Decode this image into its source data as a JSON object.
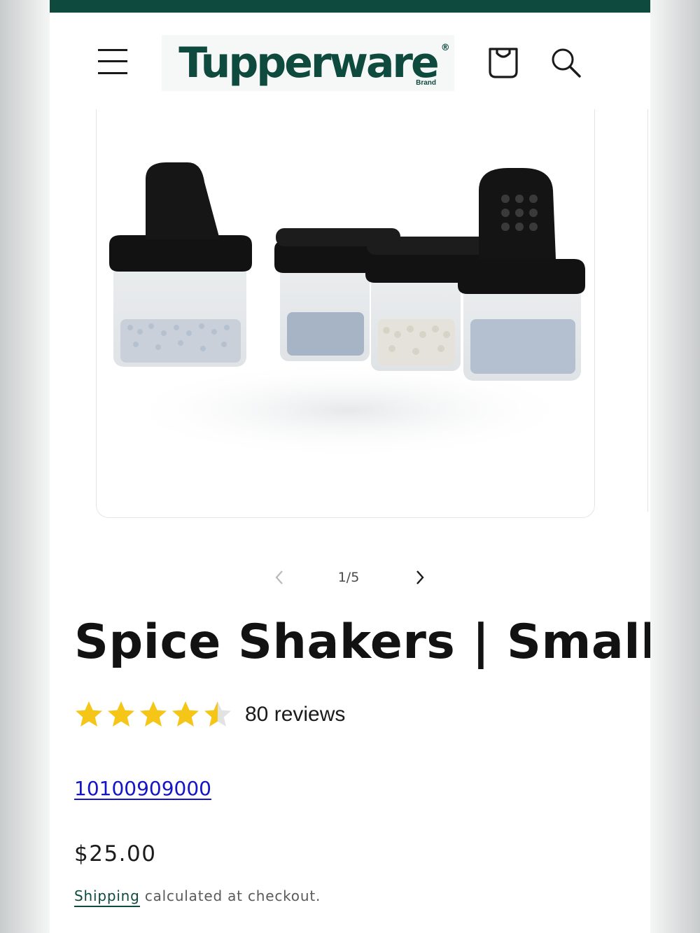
{
  "header": {
    "logo_text": "Tupperware",
    "logo_registered": "®",
    "logo_subtext": "Brand",
    "menu_icon": "hamburger-menu-icon",
    "cart_icon": "shopping-bag-icon",
    "search_icon": "search-icon",
    "accent_color": "#0f4a3e"
  },
  "gallery": {
    "image_subject": "product-photo-spice-shakers",
    "pager": {
      "prev_icon": "chevron-left-icon",
      "next_icon": "chevron-right-icon",
      "counter": "1/5",
      "current": 1,
      "total": 5
    }
  },
  "product": {
    "title": "Spice Shakers | Small",
    "rating": 4.5,
    "rating_max": 5,
    "star_color": "#f5c518",
    "reviews_label": "80 reviews",
    "sku": "10100909000",
    "price": "$25.00",
    "shipping_link": "Shipping",
    "shipping_suffix": " calculated at checkout."
  }
}
